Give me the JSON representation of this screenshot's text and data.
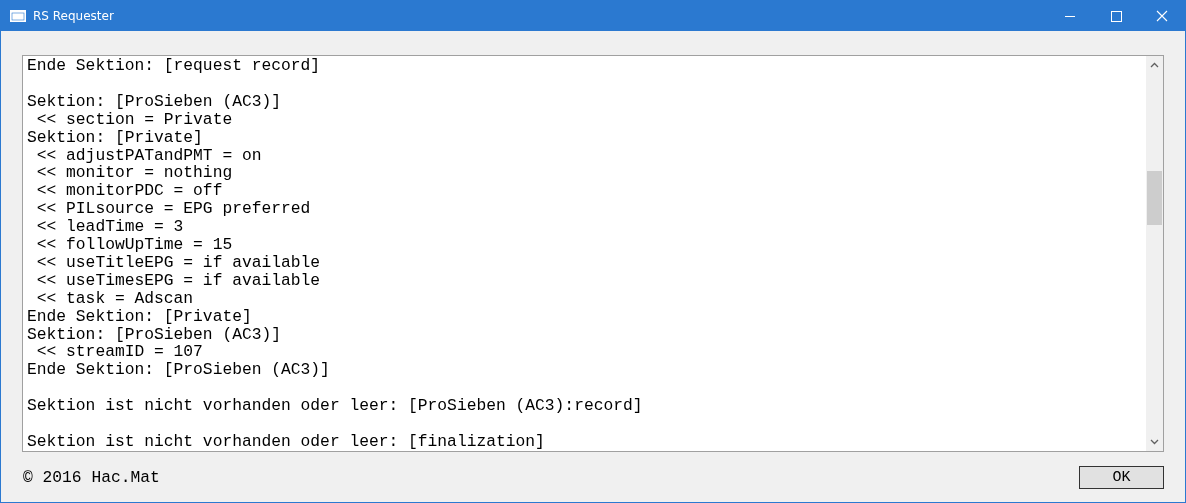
{
  "window": {
    "title": "RS Requester"
  },
  "log": {
    "blocks": [
      [
        "Ende Sektion: [request record]"
      ],
      [
        "Sektion: [ProSieben (AC3)]",
        " << section = Private",
        "Sektion: [Private]",
        " << adjustPATandPMT = on",
        " << monitor = nothing",
        " << monitorPDC = off",
        " << PILsource = EPG preferred",
        " << leadTime = 3",
        " << followUpTime = 15",
        " << useTitleEPG = if available",
        " << useTimesEPG = if available",
        " << task = Adscan",
        "Ende Sektion: [Private]",
        "Sektion: [ProSieben (AC3)]",
        " << streamID = 107",
        "Ende Sektion: [ProSieben (AC3)]"
      ],
      [
        "Sektion ist nicht vorhanden oder leer: [ProSieben (AC3):record]"
      ],
      [
        "Sektion ist nicht vorhanden oder leer: [finalization]"
      ]
    ]
  },
  "footer": {
    "copyright": "© 2016 Hac.Mat",
    "button": "OK"
  }
}
